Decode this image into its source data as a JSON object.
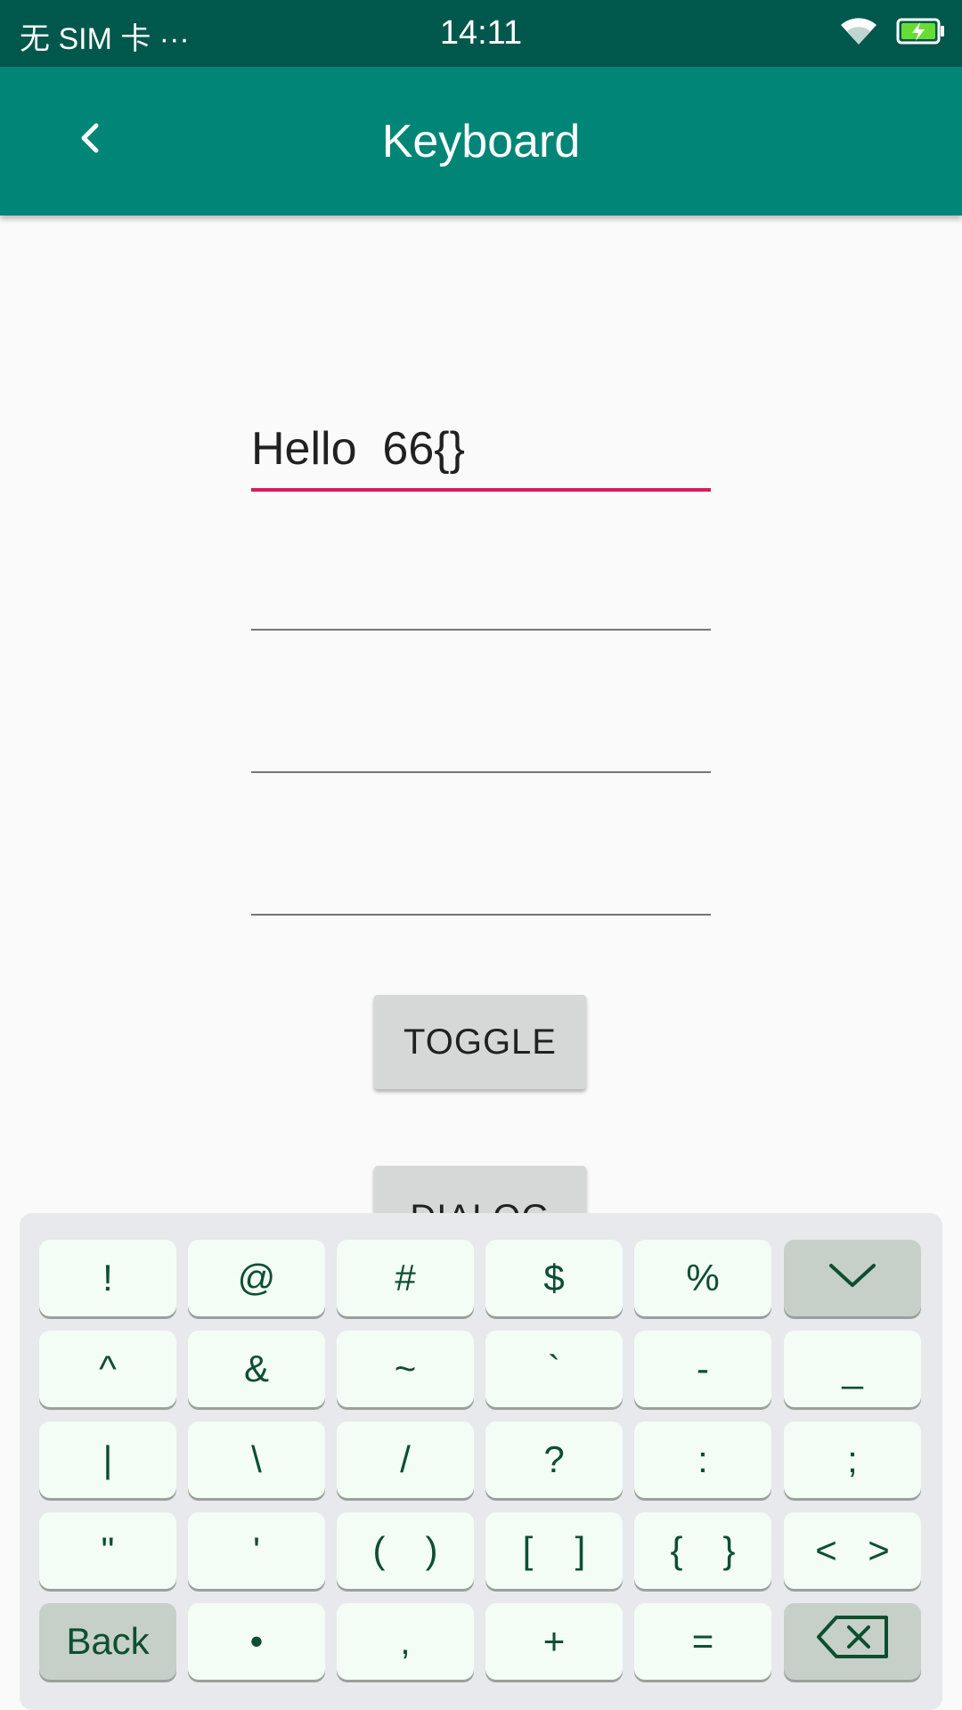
{
  "status_bar": {
    "carrier": "无 SIM 卡 ···",
    "time": "14:11",
    "icons": [
      "wifi-icon",
      "battery-charging-icon"
    ]
  },
  "app_bar": {
    "title": "Keyboard",
    "back_icon": "chevron-left-icon"
  },
  "fields": [
    {
      "value": "Hello  66{}",
      "focused": true
    },
    {
      "value": "",
      "focused": false
    },
    {
      "value": "",
      "focused": false
    },
    {
      "value": "",
      "focused": false
    }
  ],
  "buttons": {
    "toggle": "TOGGLE",
    "dialog": "DIALOG"
  },
  "keyboard": {
    "rows": [
      [
        "!",
        "@",
        "#",
        "$",
        "%",
        "hide"
      ],
      [
        "^",
        "&",
        "~",
        "`",
        "-",
        "_"
      ],
      [
        "|",
        "\\",
        "/",
        "?",
        ":",
        ";"
      ],
      [
        "\"",
        "'",
        [
          "(",
          ")"
        ],
        [
          "[",
          "]"
        ],
        [
          "{",
          "}"
        ],
        [
          "<",
          ">"
        ]
      ],
      [
        "Back",
        "•",
        ",",
        "+",
        "=",
        "delete"
      ]
    ],
    "hide_icon": "chevron-down-icon",
    "delete_icon": "backspace-icon"
  },
  "colors": {
    "status_bar": "#00574b",
    "app_bar": "#008577",
    "accent": "#d81b60",
    "key_text": "#0c4f30"
  }
}
